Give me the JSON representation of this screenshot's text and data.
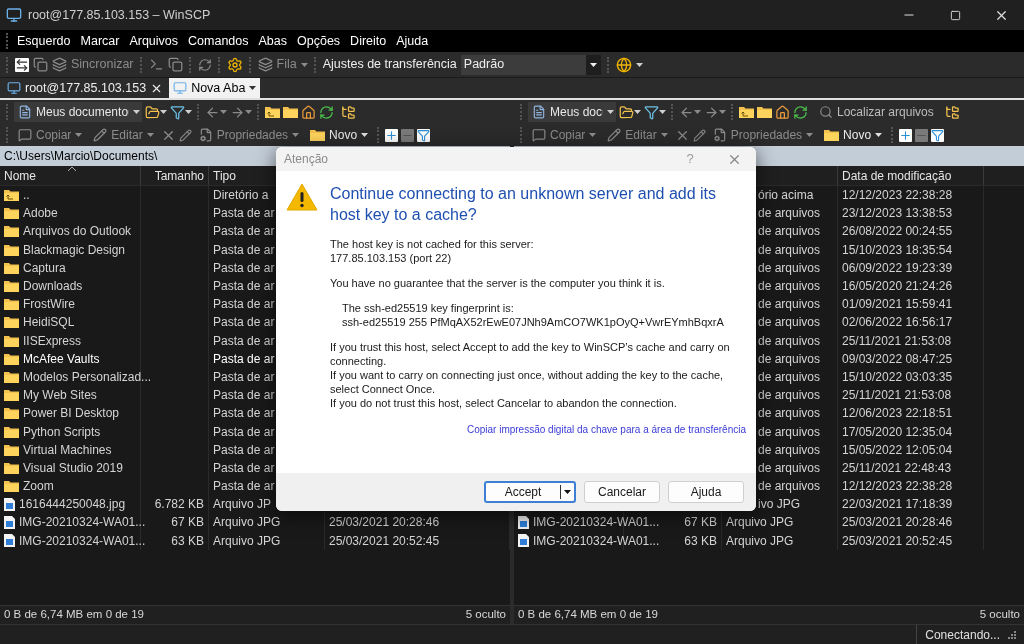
{
  "window": {
    "title": "root@177.85.103.153 – WinSCP"
  },
  "menu": [
    "Esquerdo",
    "Marcar",
    "Arquivos",
    "Comandos",
    "Abas",
    "Opções",
    "Direito",
    "Ajuda"
  ],
  "toolbar": {
    "synchronize": {
      "label": "Sincronizar",
      "disabled": true
    },
    "queue": {
      "label": "Fila",
      "disabled": true
    },
    "transfer_label": "Ajustes de transferência",
    "transfer_preset": "Padrão"
  },
  "tabs": [
    {
      "label": "root@177.85.103.153",
      "selected": false
    },
    {
      "label": "Nova Aba",
      "selected": true
    }
  ],
  "left_panel": {
    "location": "Meus documento",
    "buttons": [
      {
        "label": "Copiar",
        "disabled": true
      },
      {
        "label": "Editar",
        "disabled": true
      },
      {
        "label": "Propriedades",
        "disabled": true
      },
      {
        "label": "Novo",
        "disabled": false
      }
    ],
    "path": "C:\\Users\\Marcio\\Documents\\",
    "columns": [
      {
        "label": "Nome"
      },
      {
        "label": "Tamanho"
      },
      {
        "label": "Tipo"
      }
    ],
    "rows": [
      {
        "kind": "parent",
        "name": "..",
        "type": "Diretório a",
        "highlighted": false
      },
      {
        "kind": "folder",
        "name": "Adobe",
        "type": "Pasta de ar",
        "highlighted": false
      },
      {
        "kind": "folder",
        "name": "Arquivos do Outlook",
        "type": "Pasta de ar",
        "highlighted": false
      },
      {
        "kind": "folder",
        "name": "Blackmagic Design",
        "type": "Pasta de ar",
        "highlighted": false
      },
      {
        "kind": "folder",
        "name": "Captura",
        "type": "Pasta de ar",
        "highlighted": false
      },
      {
        "kind": "folder",
        "name": "Downloads",
        "type": "Pasta de ar",
        "highlighted": false
      },
      {
        "kind": "folder",
        "name": "FrostWire",
        "type": "Pasta de ar",
        "highlighted": false
      },
      {
        "kind": "folder",
        "name": "HeidiSQL",
        "type": "Pasta de ar",
        "highlighted": false
      },
      {
        "kind": "folder",
        "name": "IISExpress",
        "type": "Pasta de ar",
        "highlighted": false
      },
      {
        "kind": "folder",
        "name": "McAfee Vaults",
        "type": "Pasta de ar",
        "highlighted": true
      },
      {
        "kind": "folder",
        "name": "Modelos Personalizad...",
        "type": "Pasta de ar",
        "highlighted": false
      },
      {
        "kind": "folder",
        "name": "My Web Sites",
        "type": "Pasta de ar",
        "highlighted": false
      },
      {
        "kind": "folder",
        "name": "Power BI Desktop",
        "type": "Pasta de ar",
        "highlighted": false
      },
      {
        "kind": "folder",
        "name": "Python Scripts",
        "type": "Pasta de ar",
        "highlighted": false
      },
      {
        "kind": "folder",
        "name": "Virtual Machines",
        "type": "Pasta de ar",
        "highlighted": false
      },
      {
        "kind": "folder",
        "name": "Visual Studio 2019",
        "type": "Pasta de ar",
        "highlighted": false
      },
      {
        "kind": "folder",
        "name": "Zoom",
        "type": "Pasta de ar",
        "highlighted": false
      },
      {
        "kind": "image",
        "name": "1616444250048.jpg",
        "size": "6.782 KB",
        "type": "Arquivo JP",
        "highlighted": false
      },
      {
        "kind": "image",
        "name": "IMG-20210324-WA01...",
        "size": "67 KB",
        "type": "Arquivo JPG",
        "modified": "25/03/2021 20:28:46",
        "highlighted": false
      },
      {
        "kind": "image",
        "name": "IMG-20210324-WA01...",
        "size": "63 KB",
        "type": "Arquivo JPG",
        "modified": "25/03/2021 20:52:45",
        "highlighted": false
      }
    ],
    "status": "0 B de 6,74 MB em 0 de 19",
    "hidden_count": "5 oculto"
  },
  "right_panel": {
    "location": "Meus doc",
    "find_label": "Localizar arquivos",
    "buttons": [
      {
        "label": "Copiar",
        "disabled": true
      },
      {
        "label": "Editar",
        "disabled": true
      },
      {
        "label": "Propriedades",
        "disabled": true
      },
      {
        "label": "Novo",
        "disabled": false
      }
    ],
    "columns": [
      {
        "label": "Data de modificação"
      }
    ],
    "rows": [
      {
        "type": "ório acima",
        "modified": "12/12/2023 22:38:28"
      },
      {
        "type": "de arquivos",
        "modified": "23/12/2023 13:38:53"
      },
      {
        "type": "de arquivos",
        "modified": "26/08/2022 00:24:55"
      },
      {
        "type": "de arquivos",
        "modified": "15/10/2023 18:35:54"
      },
      {
        "type": "de arquivos",
        "modified": "06/09/2022 19:23:39"
      },
      {
        "type": "de arquivos",
        "modified": "16/05/2020 21:24:26"
      },
      {
        "type": "de arquivos",
        "modified": "01/09/2021 15:59:41"
      },
      {
        "type": "de arquivos",
        "modified": "02/06/2022 16:56:17"
      },
      {
        "type": "de arquivos",
        "modified": "25/11/2021 21:53:08"
      },
      {
        "type": "de arquivos",
        "modified": "09/03/2022 08:47:25"
      },
      {
        "type": "de arquivos",
        "modified": "15/10/2022 03:03:35"
      },
      {
        "type": "de arquivos",
        "modified": "25/11/2021 21:53:08"
      },
      {
        "type": "de arquivos",
        "modified": "12/06/2023 22:18:51"
      },
      {
        "type": "de arquivos",
        "modified": "17/05/2020 12:35:04"
      },
      {
        "type": "de arquivos",
        "modified": "15/05/2022 12:05:04"
      },
      {
        "type": "de arquivos",
        "modified": "25/11/2021 22:48:43"
      },
      {
        "type": "de arquivos",
        "modified": "12/12/2023 22:38:28"
      },
      {
        "type": "ivo JPG",
        "modified": "22/03/2021 17:18:39"
      },
      {
        "kind": "image",
        "name": "IMG-20210324-WA01...",
        "size": "67 KB",
        "type": "Arquivo JPG",
        "modified": "25/03/2021 20:28:46"
      },
      {
        "kind": "image",
        "name": "IMG-20210324-WA01...",
        "size": "63 KB",
        "type": "Arquivo JPG",
        "modified": "25/03/2021 20:52:45"
      }
    ],
    "status": "0 B de 6,74 MB em 0 de 19",
    "hidden_count": "5 oculto"
  },
  "dialog": {
    "title": "Atenção",
    "help_button": "?",
    "heading": "Continue connecting to an unknown server and add its host key to a cache?",
    "blocks": [
      {
        "kind": "text",
        "lines": [
          "The host key is not cached for this server:",
          "177.85.103.153 (port 22)"
        ]
      },
      {
        "kind": "text",
        "lines": [
          "You have no guarantee that the server is the computer you think it is."
        ]
      },
      {
        "kind": "fingerprint",
        "lines": [
          "The ssh-ed25519 key fingerprint is:",
          "ssh-ed25519 255 PfMqAX52rEwE07JNh9AmCO7WK1pOyQ+VwrEYmhBqxrA"
        ]
      },
      {
        "kind": "text",
        "lines": [
          "If you trust this host, select Accept to add the key to WinSCP’s cache and carry on connecting.",
          "If you want to carry on connecting just once, without adding the key to the cache, select Connect Once.",
          "If you do not trust this host, select Cancelar to abandon the connection."
        ]
      }
    ],
    "link": "Copiar impressão digital da chave para a área de transferência",
    "buttons": [
      {
        "label": "Accept",
        "default": true,
        "split": true
      },
      {
        "label": "Cancelar",
        "default": false,
        "split": false
      },
      {
        "label": "Ajuda",
        "default": false,
        "split": false
      }
    ]
  },
  "status_bar": "Conectando..."
}
